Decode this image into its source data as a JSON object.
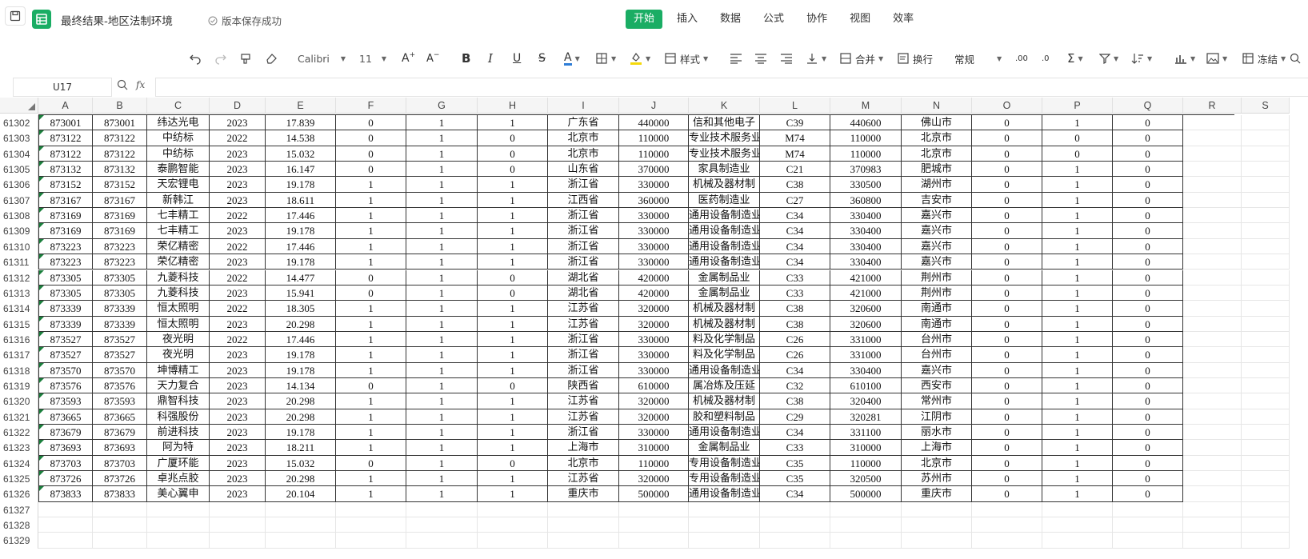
{
  "title_bar": {
    "doc_title": "最终结果-地区法制环境",
    "save_status": "版本保存成功",
    "menu": [
      "开始",
      "插入",
      "数据",
      "公式",
      "协作",
      "视图",
      "效率"
    ],
    "active_menu": "开始"
  },
  "toolbar": {
    "font_name": "Calibri",
    "font_size": "11",
    "style_label": "样式",
    "merge_label": "合并",
    "wrap_label": "换行",
    "number_format": "常规",
    "freeze_label": "冻结"
  },
  "formula_bar": {
    "name_box": "U17",
    "fx_label": "fx",
    "formula": ""
  },
  "columns": [
    "A",
    "B",
    "C",
    "D",
    "E",
    "F",
    "G",
    "H",
    "I",
    "J",
    "K",
    "L",
    "M",
    "N",
    "O",
    "P",
    "Q",
    "R",
    "S"
  ],
  "rows": [
    {
      "n": "61302",
      "c": [
        "873001",
        "873001",
        "纬达光电",
        "2023",
        "17.839",
        "0",
        "1",
        "1",
        "广东省",
        "440000",
        "信和其他电子",
        "C39",
        "440600",
        "佛山市",
        "0",
        "1",
        "0"
      ]
    },
    {
      "n": "61303",
      "c": [
        "873122",
        "873122",
        "中纺标",
        "2022",
        "14.538",
        "0",
        "1",
        "0",
        "北京市",
        "110000",
        "专业技术服务业",
        "M74",
        "110000",
        "北京市",
        "0",
        "0",
        "0"
      ]
    },
    {
      "n": "61304",
      "c": [
        "873122",
        "873122",
        "中纺标",
        "2023",
        "15.032",
        "0",
        "1",
        "0",
        "北京市",
        "110000",
        "专业技术服务业",
        "M74",
        "110000",
        "北京市",
        "0",
        "0",
        "0"
      ]
    },
    {
      "n": "61305",
      "c": [
        "873132",
        "873132",
        "泰鹏智能",
        "2023",
        "16.147",
        "0",
        "1",
        "0",
        "山东省",
        "370000",
        "家具制造业",
        "C21",
        "370983",
        "肥城市",
        "0",
        "1",
        "0"
      ]
    },
    {
      "n": "61306",
      "c": [
        "873152",
        "873152",
        "天宏锂电",
        "2023",
        "19.178",
        "1",
        "1",
        "1",
        "浙江省",
        "330000",
        "机械及器材制",
        "C38",
        "330500",
        "湖州市",
        "0",
        "1",
        "0"
      ]
    },
    {
      "n": "61307",
      "c": [
        "873167",
        "873167",
        "新韩江",
        "2023",
        "18.611",
        "1",
        "1",
        "1",
        "江西省",
        "360000",
        "医药制造业",
        "C27",
        "360800",
        "吉安市",
        "0",
        "1",
        "0"
      ]
    },
    {
      "n": "61308",
      "c": [
        "873169",
        "873169",
        "七丰精工",
        "2022",
        "17.446",
        "1",
        "1",
        "1",
        "浙江省",
        "330000",
        "通用设备制造业",
        "C34",
        "330400",
        "嘉兴市",
        "0",
        "1",
        "0"
      ]
    },
    {
      "n": "61309",
      "c": [
        "873169",
        "873169",
        "七丰精工",
        "2023",
        "19.178",
        "1",
        "1",
        "1",
        "浙江省",
        "330000",
        "通用设备制造业",
        "C34",
        "330400",
        "嘉兴市",
        "0",
        "1",
        "0"
      ]
    },
    {
      "n": "61310",
      "c": [
        "873223",
        "873223",
        "荣亿精密",
        "2022",
        "17.446",
        "1",
        "1",
        "1",
        "浙江省",
        "330000",
        "通用设备制造业",
        "C34",
        "330400",
        "嘉兴市",
        "0",
        "1",
        "0"
      ]
    },
    {
      "n": "61311",
      "c": [
        "873223",
        "873223",
        "荣亿精密",
        "2023",
        "19.178",
        "1",
        "1",
        "1",
        "浙江省",
        "330000",
        "通用设备制造业",
        "C34",
        "330400",
        "嘉兴市",
        "0",
        "1",
        "0"
      ]
    },
    {
      "n": "61312",
      "c": [
        "873305",
        "873305",
        "九菱科技",
        "2022",
        "14.477",
        "0",
        "1",
        "0",
        "湖北省",
        "420000",
        "金属制品业",
        "C33",
        "421000",
        "荆州市",
        "0",
        "1",
        "0"
      ]
    },
    {
      "n": "61313",
      "c": [
        "873305",
        "873305",
        "九菱科技",
        "2023",
        "15.941",
        "0",
        "1",
        "0",
        "湖北省",
        "420000",
        "金属制品业",
        "C33",
        "421000",
        "荆州市",
        "0",
        "1",
        "0"
      ]
    },
    {
      "n": "61314",
      "c": [
        "873339",
        "873339",
        "恒太照明",
        "2022",
        "18.305",
        "1",
        "1",
        "1",
        "江苏省",
        "320000",
        "机械及器材制",
        "C38",
        "320600",
        "南通市",
        "0",
        "1",
        "0"
      ]
    },
    {
      "n": "61315",
      "c": [
        "873339",
        "873339",
        "恒太照明",
        "2023",
        "20.298",
        "1",
        "1",
        "1",
        "江苏省",
        "320000",
        "机械及器材制",
        "C38",
        "320600",
        "南通市",
        "0",
        "1",
        "0"
      ]
    },
    {
      "n": "61316",
      "c": [
        "873527",
        "873527",
        "夜光明",
        "2022",
        "17.446",
        "1",
        "1",
        "1",
        "浙江省",
        "330000",
        "料及化学制品",
        "C26",
        "331000",
        "台州市",
        "0",
        "1",
        "0"
      ]
    },
    {
      "n": "61317",
      "c": [
        "873527",
        "873527",
        "夜光明",
        "2023",
        "19.178",
        "1",
        "1",
        "1",
        "浙江省",
        "330000",
        "料及化学制品",
        "C26",
        "331000",
        "台州市",
        "0",
        "1",
        "0"
      ]
    },
    {
      "n": "61318",
      "c": [
        "873570",
        "873570",
        "坤博精工",
        "2023",
        "19.178",
        "1",
        "1",
        "1",
        "浙江省",
        "330000",
        "通用设备制造业",
        "C34",
        "330400",
        "嘉兴市",
        "0",
        "1",
        "0"
      ]
    },
    {
      "n": "61319",
      "c": [
        "873576",
        "873576",
        "天力复合",
        "2023",
        "14.134",
        "0",
        "1",
        "0",
        "陕西省",
        "610000",
        "属冶炼及压延",
        "C32",
        "610100",
        "西安市",
        "0",
        "1",
        "0"
      ]
    },
    {
      "n": "61320",
      "c": [
        "873593",
        "873593",
        "鼎智科技",
        "2023",
        "20.298",
        "1",
        "1",
        "1",
        "江苏省",
        "320000",
        "机械及器材制",
        "C38",
        "320400",
        "常州市",
        "0",
        "1",
        "0"
      ]
    },
    {
      "n": "61321",
      "c": [
        "873665",
        "873665",
        "科强股份",
        "2023",
        "20.298",
        "1",
        "1",
        "1",
        "江苏省",
        "320000",
        "胶和塑料制品",
        "C29",
        "320281",
        "江阴市",
        "0",
        "1",
        "0"
      ]
    },
    {
      "n": "61322",
      "c": [
        "873679",
        "873679",
        "前进科技",
        "2023",
        "19.178",
        "1",
        "1",
        "1",
        "浙江省",
        "330000",
        "通用设备制造业",
        "C34",
        "331100",
        "丽水市",
        "0",
        "1",
        "0"
      ]
    },
    {
      "n": "61323",
      "c": [
        "873693",
        "873693",
        "阿为特",
        "2023",
        "18.211",
        "1",
        "1",
        "1",
        "上海市",
        "310000",
        "金属制品业",
        "C33",
        "310000",
        "上海市",
        "0",
        "1",
        "0"
      ]
    },
    {
      "n": "61324",
      "c": [
        "873703",
        "873703",
        "广厦环能",
        "2023",
        "15.032",
        "0",
        "1",
        "0",
        "北京市",
        "110000",
        "专用设备制造业",
        "C35",
        "110000",
        "北京市",
        "0",
        "1",
        "0"
      ]
    },
    {
      "n": "61325",
      "c": [
        "873726",
        "873726",
        "卓兆点胶",
        "2023",
        "20.298",
        "1",
        "1",
        "1",
        "江苏省",
        "320000",
        "专用设备制造业",
        "C35",
        "320500",
        "苏州市",
        "0",
        "1",
        "0"
      ]
    },
    {
      "n": "61326",
      "c": [
        "873833",
        "873833",
        "美心翼申",
        "2023",
        "20.104",
        "1",
        "1",
        "1",
        "重庆市",
        "500000",
        "通用设备制造业",
        "C34",
        "500000",
        "重庆市",
        "0",
        "1",
        "0"
      ]
    }
  ],
  "empty_rows": [
    "61327",
    "61328",
    "61329"
  ]
}
